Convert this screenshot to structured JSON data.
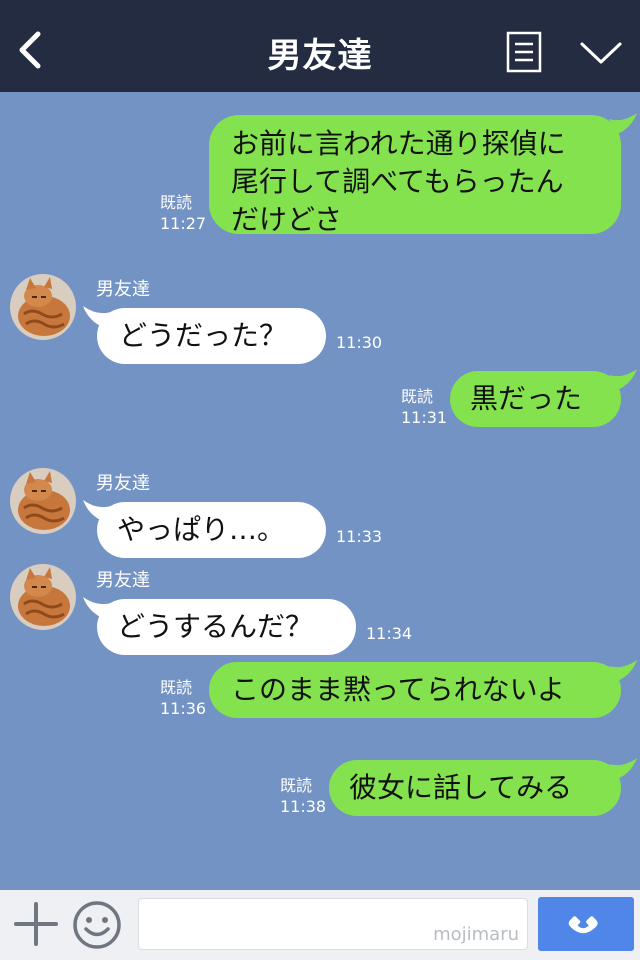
{
  "header": {
    "title": "男友達"
  },
  "messages": [
    {
      "dir": "out",
      "lines": [
        "お前に言われた通り探偵に",
        "尾行して調べてもらったん",
        "だけどさ"
      ],
      "read": "既読",
      "time": "11:27"
    },
    {
      "dir": "in",
      "sender": "男友達",
      "text": "どうだった？",
      "time": "11:30"
    },
    {
      "dir": "out",
      "text": "黒だった",
      "read": "既読",
      "time": "11:31"
    },
    {
      "dir": "in",
      "sender": "男友達",
      "text": "やっぱり…。",
      "time": "11:33"
    },
    {
      "dir": "in",
      "sender": "男友達",
      "text": "どうするんだ？",
      "time": "11:34"
    },
    {
      "dir": "out",
      "text": "このまま黙ってられないよ",
      "read": "既読",
      "time": "11:36"
    },
    {
      "dir": "out",
      "text": "彼女に話してみる",
      "read": "既読",
      "time": "11:38"
    }
  ],
  "footer": {
    "input_value": "",
    "watermark": "mojimaru"
  },
  "colors": {
    "header_bg": "#232c41",
    "chat_bg": "#7393c4",
    "outgoing_bubble": "#84e24f",
    "incoming_bubble": "#ffffff",
    "call_button": "#4f86e8"
  },
  "icons": [
    "back-icon",
    "menu-icon",
    "chevron-down-icon",
    "plus-icon",
    "emoji-icon",
    "phone-icon"
  ]
}
